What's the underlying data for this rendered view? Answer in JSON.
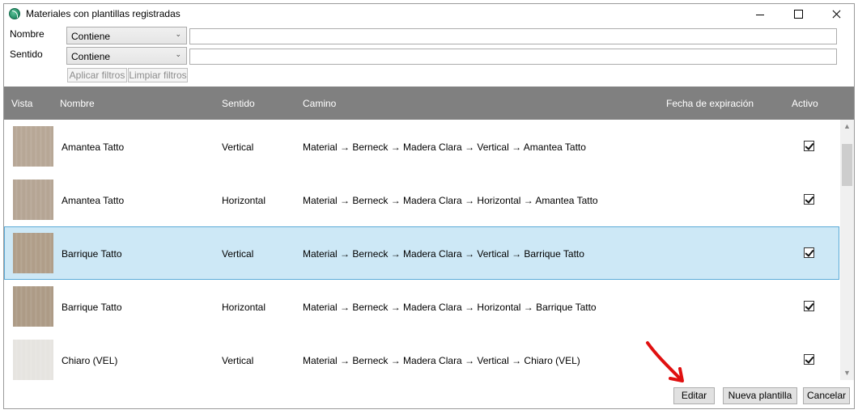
{
  "window": {
    "title": "Materiales con plantillas registradas"
  },
  "filters": {
    "nombre": {
      "label": "Nombre",
      "operator": "Contiene",
      "value": ""
    },
    "sentido": {
      "label": "Sentido",
      "operator": "Contiene",
      "value": ""
    },
    "apply_label": "Aplicar filtros",
    "clear_label": "Limpiar filtros"
  },
  "grid": {
    "columns": {
      "vista": "Vista",
      "nombre": "Nombre",
      "sentido": "Sentido",
      "camino": "Camino",
      "fecha": "Fecha de expiración",
      "activo": "Activo"
    },
    "rows": [
      {
        "nombre": "Amantea Tatto",
        "sentido": "Vertical",
        "camino": "Material → Berneck → Madera Clara → Vertical → Amantea Tatto",
        "fecha": "",
        "activo": true,
        "thumb_color": "#b7a796"
      },
      {
        "nombre": "Amantea Tatto",
        "sentido": "Horizontal",
        "camino": "Material → Berneck → Madera Clara → Horizontal → Amantea Tatto",
        "fecha": "",
        "activo": true,
        "thumb_color": "#b5a594"
      },
      {
        "nombre": "Barrique Tatto",
        "sentido": "Vertical",
        "camino": "Material → Berneck → Madera Clara → Vertical → Barrique Tatto",
        "fecha": "",
        "activo": true,
        "thumb_color": "#b09e89",
        "selected": true
      },
      {
        "nombre": "Barrique Tatto",
        "sentido": "Horizontal",
        "camino": "Material → Berneck → Madera Clara → Horizontal → Barrique Tatto",
        "fecha": "",
        "activo": true,
        "thumb_color": "#ad9b86"
      },
      {
        "nombre": "Chiaro (VEL)",
        "sentido": "Vertical",
        "camino": "Material → Berneck → Madera Clara → Vertical → Chiaro (VEL)",
        "fecha": "",
        "activo": true,
        "thumb_color": "#e6e4e0"
      }
    ]
  },
  "buttons": {
    "editar": "Editar",
    "nueva": "Nueva plantilla",
    "cancelar": "Cancelar"
  },
  "colors": {
    "header_bg": "#808080",
    "selected_row": "#cde8f6",
    "selected_border": "#5aaad7",
    "annotation_arrow": "#e01010"
  },
  "icons": {
    "app": "app-logo-icon",
    "minimize": "minimize-icon",
    "maximize": "maximize-icon",
    "close": "close-icon",
    "dropdown": "chevron-down-icon",
    "checkbox": "checkbox-checked-icon",
    "annotation": "red-arrow-annotation"
  }
}
